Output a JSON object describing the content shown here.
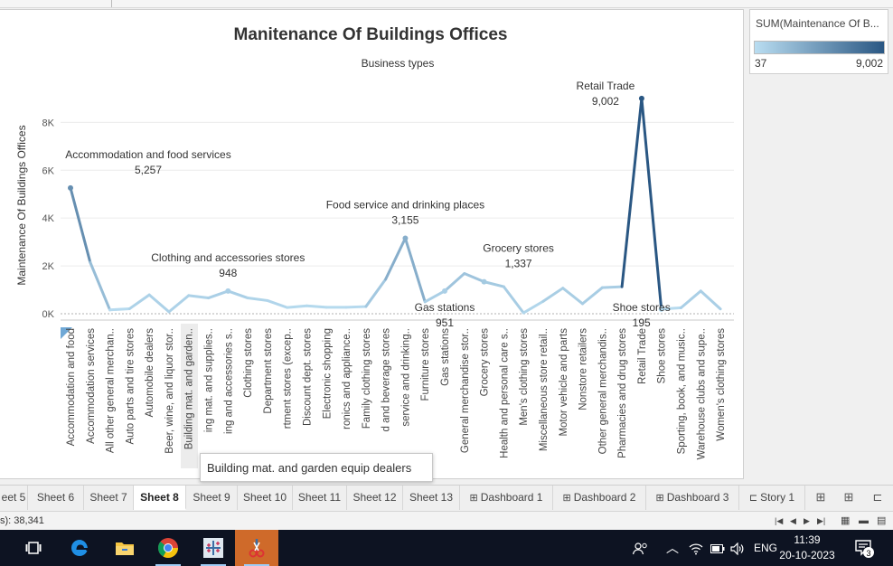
{
  "sheet": {
    "title": "Manitenance Of Buildings Offices",
    "column_header": "Business types",
    "y_axis_label": "Maintenance Of Buildings Offices"
  },
  "legend": {
    "title": "SUM(Maintenance Of B...",
    "min_label": "37",
    "max_label": "9,002",
    "color_low": "#b9ddf1",
    "color_high": "#2a5783"
  },
  "tooltip": {
    "text": "Building mat. and garden equip dealers"
  },
  "chart_data": {
    "type": "line",
    "title": "Manitenance Of Buildings Offices",
    "xlabel": "Business types",
    "ylabel": "Maintenance Of Buildings Offices",
    "ylim": [
      0,
      9600
    ],
    "yticks": [
      0,
      2000,
      4000,
      6000,
      8000
    ],
    "ytick_labels": [
      "0K",
      "2K",
      "4K",
      "6K",
      "8K"
    ],
    "grid": true,
    "color_by_value": true,
    "color_low": "#b9ddf1",
    "color_high": "#2a5783",
    "categories": [
      "Accommodation and food",
      "Accommodation services",
      "All other general merchan..",
      "Auto parts and tire stores",
      "Automobile dealers",
      "Beer, wine, and liquor stor..",
      "Building mat. and garden..",
      "ing mat. and supplies..",
      "ing and accessories s..",
      "Clothing stores",
      "Department stores",
      "rtment stores (excep..",
      "Discount dept. stores",
      "Electronic shopping",
      "ronics and appliance..",
      "Family clothing stores",
      "d and beverage stores",
      "service and drinking..",
      "Furniture stores",
      "Gas stations",
      "General merchandise stor..",
      "Grocery stores",
      "Health and personal care s..",
      "Men's clothing stores",
      "Miscellaneous store retail..",
      "Motor vehicle and parts",
      "Nonstore retailers",
      "Other general merchandis..",
      "Pharmacies and drug stores",
      "Retail Trade",
      "Shoe stores",
      "Sporting, book, and music..",
      "Warehouse clubs and supe..",
      "Women's clothing stores"
    ],
    "values": [
      5257,
      2150,
      160,
      210,
      790,
      80,
      760,
      660,
      948,
      660,
      550,
      260,
      330,
      270,
      270,
      300,
      1440,
      3155,
      500,
      951,
      1680,
      1337,
      1130,
      37,
      520,
      1070,
      420,
      1090,
      1130,
      9002,
      195,
      250,
      950,
      200
    ],
    "annotations": [
      {
        "index": 0,
        "name": "Accommodation and food services",
        "value_label": "5,257"
      },
      {
        "index": 8,
        "name": "Clothing and accessories stores",
        "value_label": "948"
      },
      {
        "index": 17,
        "name": "Food service and drinking places",
        "value_label": "3,155"
      },
      {
        "index": 19,
        "name": "Gas stations",
        "value_label": "951"
      },
      {
        "index": 21,
        "name": "Grocery stores",
        "value_label": "1,337"
      },
      {
        "index": 29,
        "name": "Retail Trade",
        "value_label": "9,002"
      },
      {
        "index": 30,
        "name": "Shoe stores",
        "value_label": "195"
      }
    ]
  },
  "tabs": [
    {
      "label": "eet 5"
    },
    {
      "label": "Sheet 6"
    },
    {
      "label": "Sheet 7"
    },
    {
      "label": "Sheet 8",
      "active": true
    },
    {
      "label": "Sheet 9"
    },
    {
      "label": "Sheet 10"
    },
    {
      "label": "Sheet 11"
    },
    {
      "label": "Sheet 12"
    },
    {
      "label": "Sheet 13"
    },
    {
      "label": "Dashboard 1",
      "icon": "grid-icon"
    },
    {
      "label": "Dashboard 2",
      "icon": "grid-icon"
    },
    {
      "label": "Dashboard 3",
      "icon": "grid-icon"
    },
    {
      "label": "Story 1",
      "icon": "book-icon"
    }
  ],
  "status": {
    "text": "s): 38,341"
  },
  "taskbar": {
    "language": "ENG",
    "time": "11:39",
    "date": "20-10-2023",
    "notifications": "3"
  }
}
